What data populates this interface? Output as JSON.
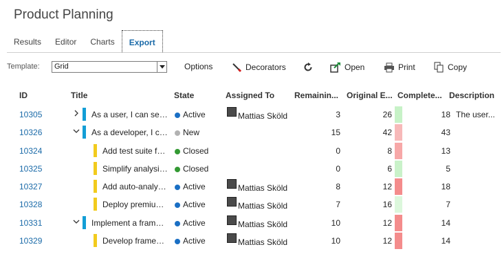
{
  "app": {
    "title": "Product Planning"
  },
  "tabs": [
    {
      "label": "Results"
    },
    {
      "label": "Editor"
    },
    {
      "label": "Charts"
    },
    {
      "label": "Export",
      "active": true
    }
  ],
  "toolbar": {
    "template_label": "Template:",
    "template_value": "Grid",
    "options_label": "Options",
    "decorators_label": "Decorators",
    "open_label": "Open",
    "print_label": "Print",
    "copy_label": "Copy"
  },
  "columns": {
    "id": "ID",
    "title": "Title",
    "state": "State",
    "assigned": "Assigned To",
    "remaining": "Remainin...",
    "original": "Original E...",
    "completed": "Complete...",
    "description": "Description"
  },
  "colors": {
    "accent": "#1a6aa8",
    "user_story": "#139ed6",
    "task": "#f2cb1d",
    "active": "#1a6fc4",
    "new": "#b2b2b2",
    "closed": "#339933"
  },
  "rows": [
    {
      "id": "10305",
      "expander": "collapsed",
      "level": 0,
      "type": "user_story",
      "title": "As a user, I can select...",
      "state": "Active",
      "state_color": "#1a6fc4",
      "assigned": "Mattias Sköld",
      "remaining": "3",
      "original": "26",
      "completed": "18",
      "swatch": "#c7f2c7",
      "description": "The user..."
    },
    {
      "id": "10326",
      "expander": "expanded",
      "level": 0,
      "type": "user_story",
      "title": "As a developer, I can...",
      "state": "New",
      "state_color": "#b2b2b2",
      "assigned": "",
      "remaining": "15",
      "original": "42",
      "completed": "43",
      "swatch": "#f7b9b9",
      "description": ""
    },
    {
      "id": "10324",
      "expander": "",
      "level": 1,
      "type": "task",
      "title": "Add test suite for...",
      "state": "Closed",
      "state_color": "#339933",
      "assigned": "",
      "remaining": "0",
      "original": "8",
      "completed": "13",
      "swatch": "#f7a8a8",
      "description": ""
    },
    {
      "id": "10325",
      "expander": "",
      "level": 1,
      "type": "task",
      "title": "Simplify analysis...",
      "state": "Closed",
      "state_color": "#339933",
      "assigned": "",
      "remaining": "0",
      "original": "6",
      "completed": "5",
      "swatch": "#c9f2c9",
      "description": ""
    },
    {
      "id": "10327",
      "expander": "",
      "level": 1,
      "type": "task",
      "title": "Add auto-analysis...",
      "state": "Active",
      "state_color": "#1a6fc4",
      "assigned": "Mattias Sköld",
      "remaining": "8",
      "original": "12",
      "completed": "18",
      "swatch": "#f48c8c",
      "description": ""
    },
    {
      "id": "10328",
      "expander": "",
      "level": 1,
      "type": "task",
      "title": "Deploy premium...",
      "state": "Active",
      "state_color": "#1a6fc4",
      "assigned": "Mattias Sköld",
      "remaining": "7",
      "original": "16",
      "completed": "7",
      "swatch": "#dcf7dc",
      "description": ""
    },
    {
      "id": "10331",
      "expander": "expanded",
      "level": 0,
      "type": "user_story",
      "title": "Implement a framework...",
      "state": "Active",
      "state_color": "#1a6fc4",
      "assigned": "Mattias Sköld",
      "remaining": "10",
      "original": "12",
      "completed": "14",
      "swatch": "#f48c8c",
      "description": ""
    },
    {
      "id": "10329",
      "expander": "",
      "level": 1,
      "type": "task",
      "title": "Develop framework...",
      "state": "Active",
      "state_color": "#1a6fc4",
      "assigned": "Mattias Sköld",
      "remaining": "10",
      "original": "12",
      "completed": "14",
      "swatch": "#f48c8c",
      "description": ""
    }
  ]
}
